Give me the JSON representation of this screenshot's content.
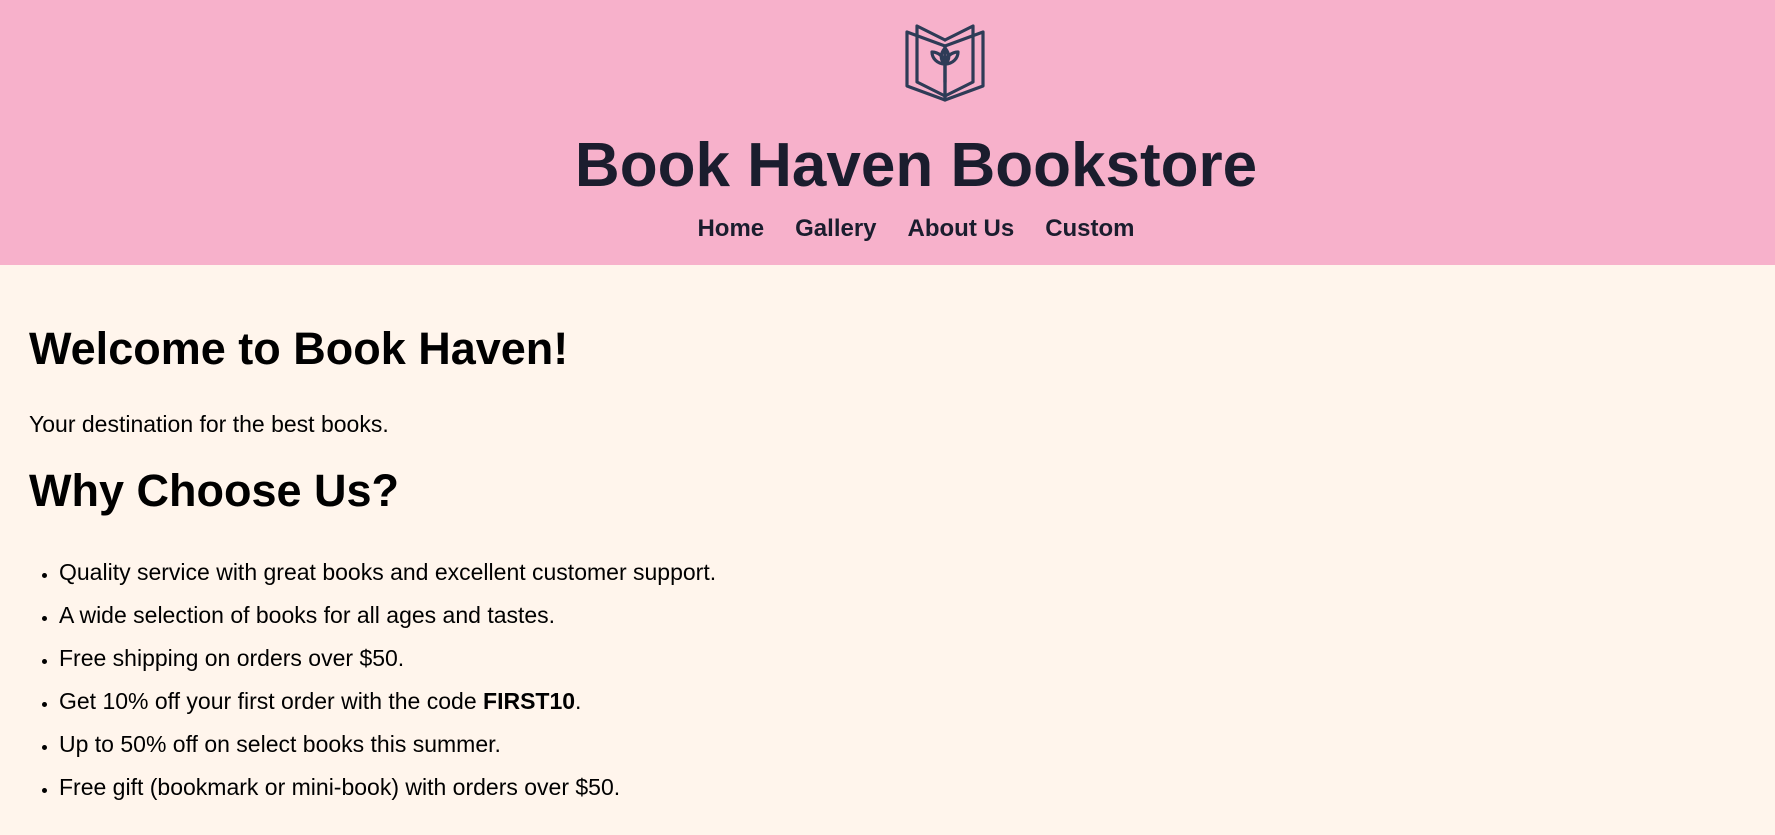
{
  "header": {
    "logo_icon": "open-book-icon",
    "title": "Book Haven Bookstore",
    "background_color": "#f7b1cb",
    "text_color": "#1b1d2e",
    "nav": [
      {
        "label": "Home"
      },
      {
        "label": "Gallery"
      },
      {
        "label": "About Us"
      },
      {
        "label": "Custom"
      }
    ]
  },
  "main": {
    "background_color": "#fff5ec",
    "welcome_heading": "Welcome to Book Haven!",
    "tagline": "Your destination for the best books.",
    "why_heading": "Why Choose Us?",
    "features": [
      {
        "text": "Quality service with great books and excellent customer support."
      },
      {
        "text": "A wide selection of books for all ages and tastes."
      },
      {
        "text": "Free shipping on orders over $50."
      },
      {
        "text_before": "Get 10% off your first order with the code ",
        "code": "FIRST10",
        "text_after": "."
      },
      {
        "text": "Up to 50% off on select books this summer."
      },
      {
        "text": "Free gift (bookmark or mini-book) with orders over $50."
      }
    ]
  }
}
